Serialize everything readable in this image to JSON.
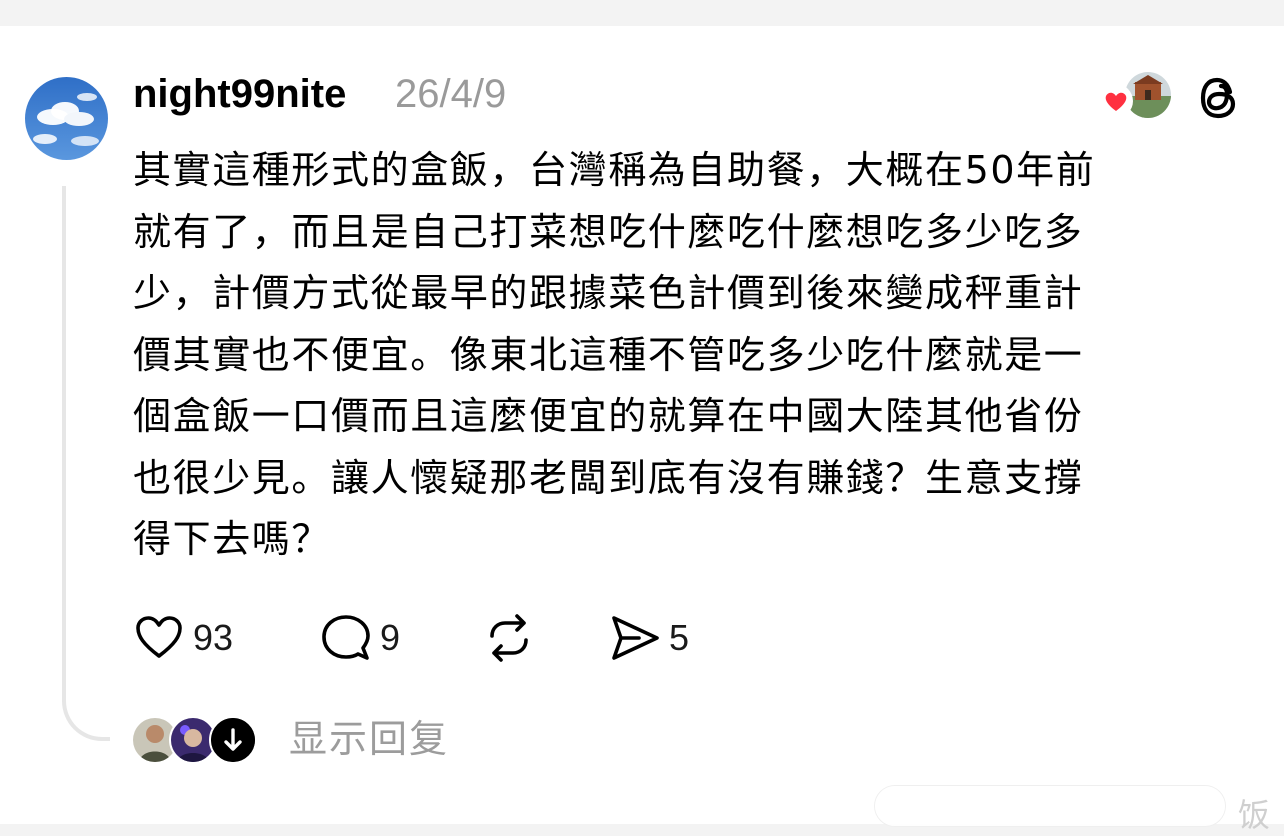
{
  "post": {
    "username": "night99nite",
    "date": "26/4/9",
    "body": "其實這種形式的盒飯，台灣稱為自助餐，大概在50年前\n就有了，而且是自己打菜想吃什麼吃什麼想吃多少吃多\n少，計價方式從最早的跟據菜色計價到後來變成秤重計\n價其實也不便宜。像東北這種不管吃多少吃什麼就是一\n個盒飯一口價而且這麼便宜的就算在中國大陸其他省份\n也很少見。讓人懷疑那老闆到底有沒有賺錢？生意支撐\n得下去嗎？"
  },
  "actions": {
    "likes": "93",
    "comments": "9",
    "shares": "5"
  },
  "replies": {
    "label": "显示回复"
  },
  "watermark": {
    "text": "饭"
  },
  "colors": {
    "heart": "#ff3040",
    "muted_text": "#9a9a9a",
    "thread_line": "#e6e6e6"
  },
  "icons": [
    "heart-icon",
    "comment-icon",
    "repost-icon",
    "share-icon",
    "threads-logo-icon",
    "arrow-down-icon"
  ]
}
